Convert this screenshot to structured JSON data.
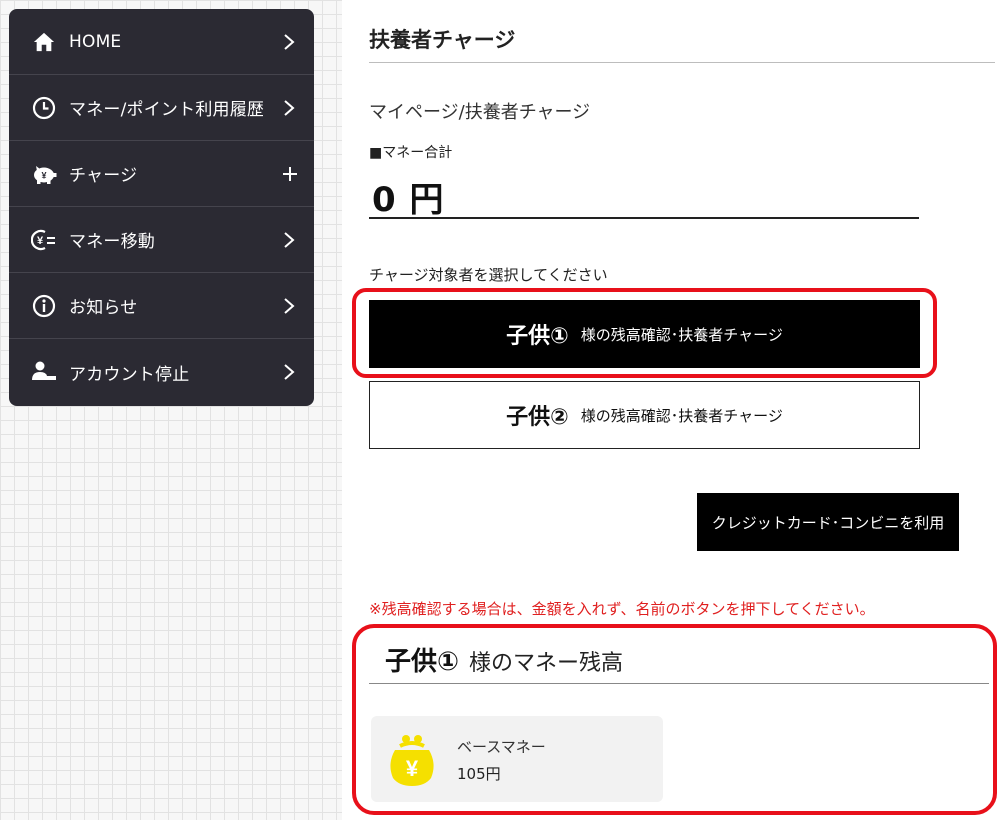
{
  "sidebar": {
    "items": [
      {
        "label": "HOME",
        "icon": "home-icon",
        "indicator": "chevron-right"
      },
      {
        "label": "マネー/ポイント利用履歴",
        "icon": "clock-icon",
        "indicator": "chevron-right"
      },
      {
        "label": "チャージ",
        "icon": "piggy-bank-icon",
        "indicator": "plus"
      },
      {
        "label": "マネー移動",
        "icon": "yen-transfer-icon",
        "indicator": "chevron-right"
      },
      {
        "label": "お知らせ",
        "icon": "info-icon",
        "indicator": "chevron-right"
      },
      {
        "label": "アカウント停止",
        "icon": "user-stop-icon",
        "indicator": "chevron-right"
      }
    ]
  },
  "main": {
    "page_title": "扶養者チャージ",
    "breadcrumb": "マイページ/扶養者チャージ",
    "total_label": "■マネー合計",
    "total_amount": "0 円",
    "select_prompt": "チャージ対象者を選択してください",
    "children": [
      {
        "name": "子供①",
        "desc": "様の残高確認･扶養者チャージ",
        "selected": true
      },
      {
        "name": "子供②",
        "desc": "様の残高確認･扶養者チャージ",
        "selected": false
      }
    ],
    "credit_button": "クレジットカード･コンビニを利用",
    "notice": "※残高確認する場合は、金額を入れず、名前のボタンを押下してください。",
    "balance": {
      "child_name": "子供①",
      "title_suffix": "様のマネー残高",
      "money_label": "ベースマネー",
      "money_value": "105円"
    }
  },
  "colors": {
    "sidebar_bg": "#2b2a33",
    "highlight": "#e8101a",
    "notice": "#e02020",
    "coin": "#f5e000"
  }
}
